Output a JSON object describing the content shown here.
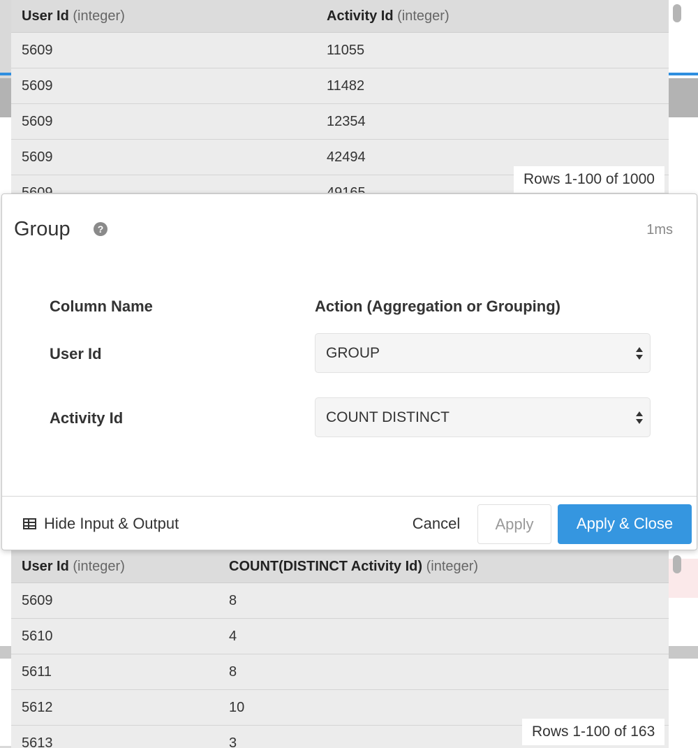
{
  "top_table": {
    "columns": [
      {
        "name": "User Id",
        "type": "(integer)"
      },
      {
        "name": "Activity Id",
        "type": "(integer)"
      }
    ],
    "rows": [
      [
        "5609",
        "11055"
      ],
      [
        "5609",
        "11482"
      ],
      [
        "5609",
        "12354"
      ],
      [
        "5609",
        "42494"
      ],
      [
        "5609",
        "49165"
      ]
    ],
    "rows_badge": "Rows 1-100 of 1000"
  },
  "modal": {
    "title": "Group",
    "help_icon": "question-circle-icon",
    "timing": "1ms",
    "column_header": "Column Name",
    "action_header": "Action (Aggregation or Grouping)",
    "fields": [
      {
        "label": "User Id",
        "action": "GROUP"
      },
      {
        "label": "Activity Id",
        "action": "COUNT DISTINCT"
      }
    ],
    "footer": {
      "toggle_label": "Hide Input & Output",
      "toggle_icon": "table-icon",
      "cancel_label": "Cancel",
      "apply_label": "Apply",
      "apply_close_label": "Apply & Close"
    }
  },
  "bottom_table": {
    "columns": [
      {
        "name": "User Id",
        "type": "(integer)"
      },
      {
        "name": "COUNT(DISTINCT Activity Id)",
        "type": "(integer)"
      }
    ],
    "rows": [
      [
        "5609",
        "8"
      ],
      [
        "5610",
        "4"
      ],
      [
        "5611",
        "8"
      ],
      [
        "5612",
        "10"
      ],
      [
        "5613",
        "3"
      ]
    ],
    "rows_badge": "Rows 1-100 of 163"
  },
  "colors": {
    "primary": "#3596e0",
    "table_bg": "#ececec",
    "header_bg": "#dcdcdc"
  }
}
